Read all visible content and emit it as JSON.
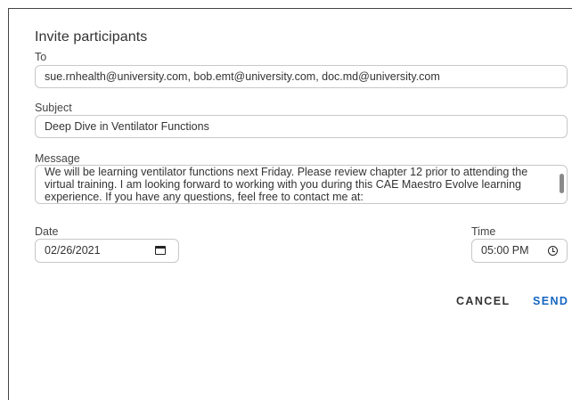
{
  "dialog": {
    "title": "Invite participants",
    "to": {
      "label": "To",
      "value": "sue.rnhealth@university.com, bob.emt@university.com, doc.md@university.com"
    },
    "subject": {
      "label": "Subject",
      "value": "Deep Dive in Ventilator Functions"
    },
    "message": {
      "label": "Message",
      "value": "We will be learning ventilator functions next Friday. Please review chapter 12 prior to attending the virtual training. I am looking forward to working with you during this CAE Maestro Evolve learning experience. If you have any questions, feel free to contact me at:"
    },
    "date": {
      "label": "Date",
      "value": "02/26/2021",
      "icon": "calendar-icon"
    },
    "time": {
      "label": "Time",
      "value": "05:00 PM",
      "icon": "clock-icon"
    },
    "actions": {
      "cancel_label": "CANCEL",
      "send_label": "SEND"
    }
  },
  "colors": {
    "accent": "#1565c0",
    "border": "#c8c8c8",
    "text": "#333333"
  }
}
